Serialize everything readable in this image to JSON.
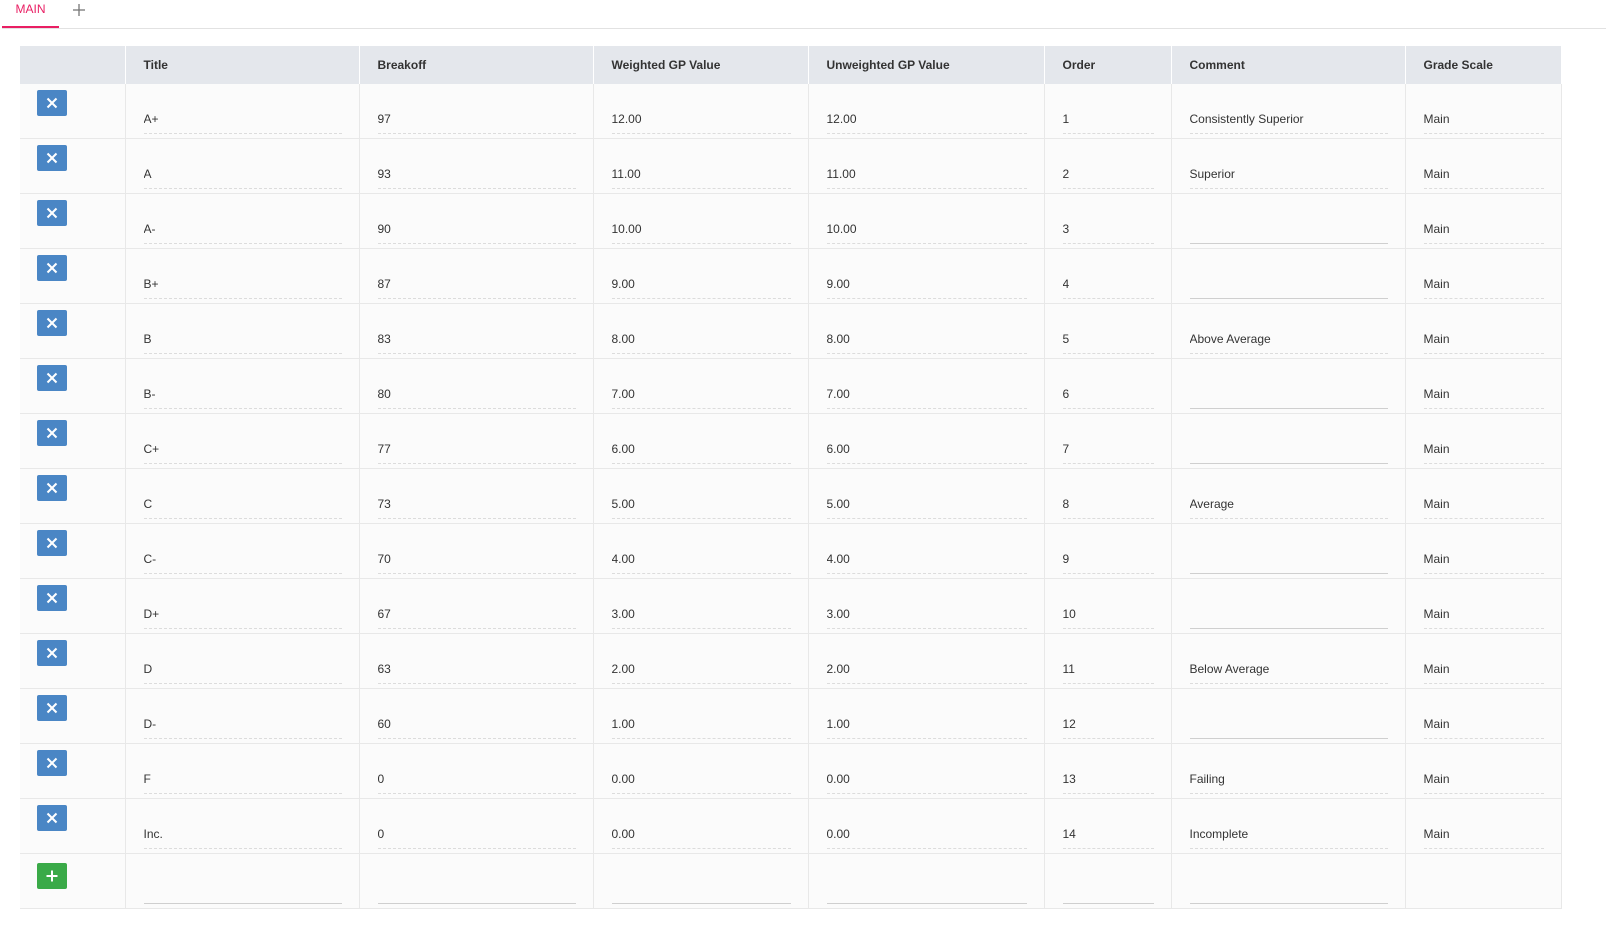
{
  "tabs": [
    {
      "label": "MAIN"
    }
  ],
  "table": {
    "columns": [
      "",
      "Title",
      "Breakoff",
      "Weighted GP Value",
      "Unweighted GP Value",
      "Order",
      "Comment",
      "Grade Scale"
    ],
    "rows": [
      {
        "title": "A+",
        "breakoff": "97",
        "weighted": "12.00",
        "unweighted": "12.00",
        "order": "1",
        "comment": "Consistently Superior",
        "scale": "Main"
      },
      {
        "title": "A",
        "breakoff": "93",
        "weighted": "11.00",
        "unweighted": "11.00",
        "order": "2",
        "comment": "Superior",
        "scale": "Main"
      },
      {
        "title": "A-",
        "breakoff": "90",
        "weighted": "10.00",
        "unweighted": "10.00",
        "order": "3",
        "comment": "",
        "scale": "Main"
      },
      {
        "title": "B+",
        "breakoff": "87",
        "weighted": "9.00",
        "unweighted": "9.00",
        "order": "4",
        "comment": "",
        "scale": "Main"
      },
      {
        "title": "B",
        "breakoff": "83",
        "weighted": "8.00",
        "unweighted": "8.00",
        "order": "5",
        "comment": "Above Average",
        "scale": "Main"
      },
      {
        "title": "B-",
        "breakoff": "80",
        "weighted": "7.00",
        "unweighted": "7.00",
        "order": "6",
        "comment": "",
        "scale": "Main"
      },
      {
        "title": "C+",
        "breakoff": "77",
        "weighted": "6.00",
        "unweighted": "6.00",
        "order": "7",
        "comment": "",
        "scale": "Main"
      },
      {
        "title": "C",
        "breakoff": "73",
        "weighted": "5.00",
        "unweighted": "5.00",
        "order": "8",
        "comment": "Average",
        "scale": "Main"
      },
      {
        "title": "C-",
        "breakoff": "70",
        "weighted": "4.00",
        "unweighted": "4.00",
        "order": "9",
        "comment": "",
        "scale": "Main"
      },
      {
        "title": "D+",
        "breakoff": "67",
        "weighted": "3.00",
        "unweighted": "3.00",
        "order": "10",
        "comment": "",
        "scale": "Main"
      },
      {
        "title": "D",
        "breakoff": "63",
        "weighted": "2.00",
        "unweighted": "2.00",
        "order": "11",
        "comment": "Below Average",
        "scale": "Main"
      },
      {
        "title": "D-",
        "breakoff": "60",
        "weighted": "1.00",
        "unweighted": "1.00",
        "order": "12",
        "comment": "",
        "scale": "Main"
      },
      {
        "title": "F",
        "breakoff": "0",
        "weighted": "0.00",
        "unweighted": "0.00",
        "order": "13",
        "comment": "Failing",
        "scale": "Main"
      },
      {
        "title": "Inc.",
        "breakoff": "0",
        "weighted": "0.00",
        "unweighted": "0.00",
        "order": "14",
        "comment": "Incomplete",
        "scale": "Main"
      }
    ]
  },
  "icons": {
    "delete": "close-icon",
    "add": "plus-icon",
    "tab_add": "plus-icon"
  },
  "colors": {
    "accent": "#e91e63",
    "delete_button": "#4a86c5",
    "add_button": "#3aaa48",
    "header_bg": "#e4e7ec"
  }
}
